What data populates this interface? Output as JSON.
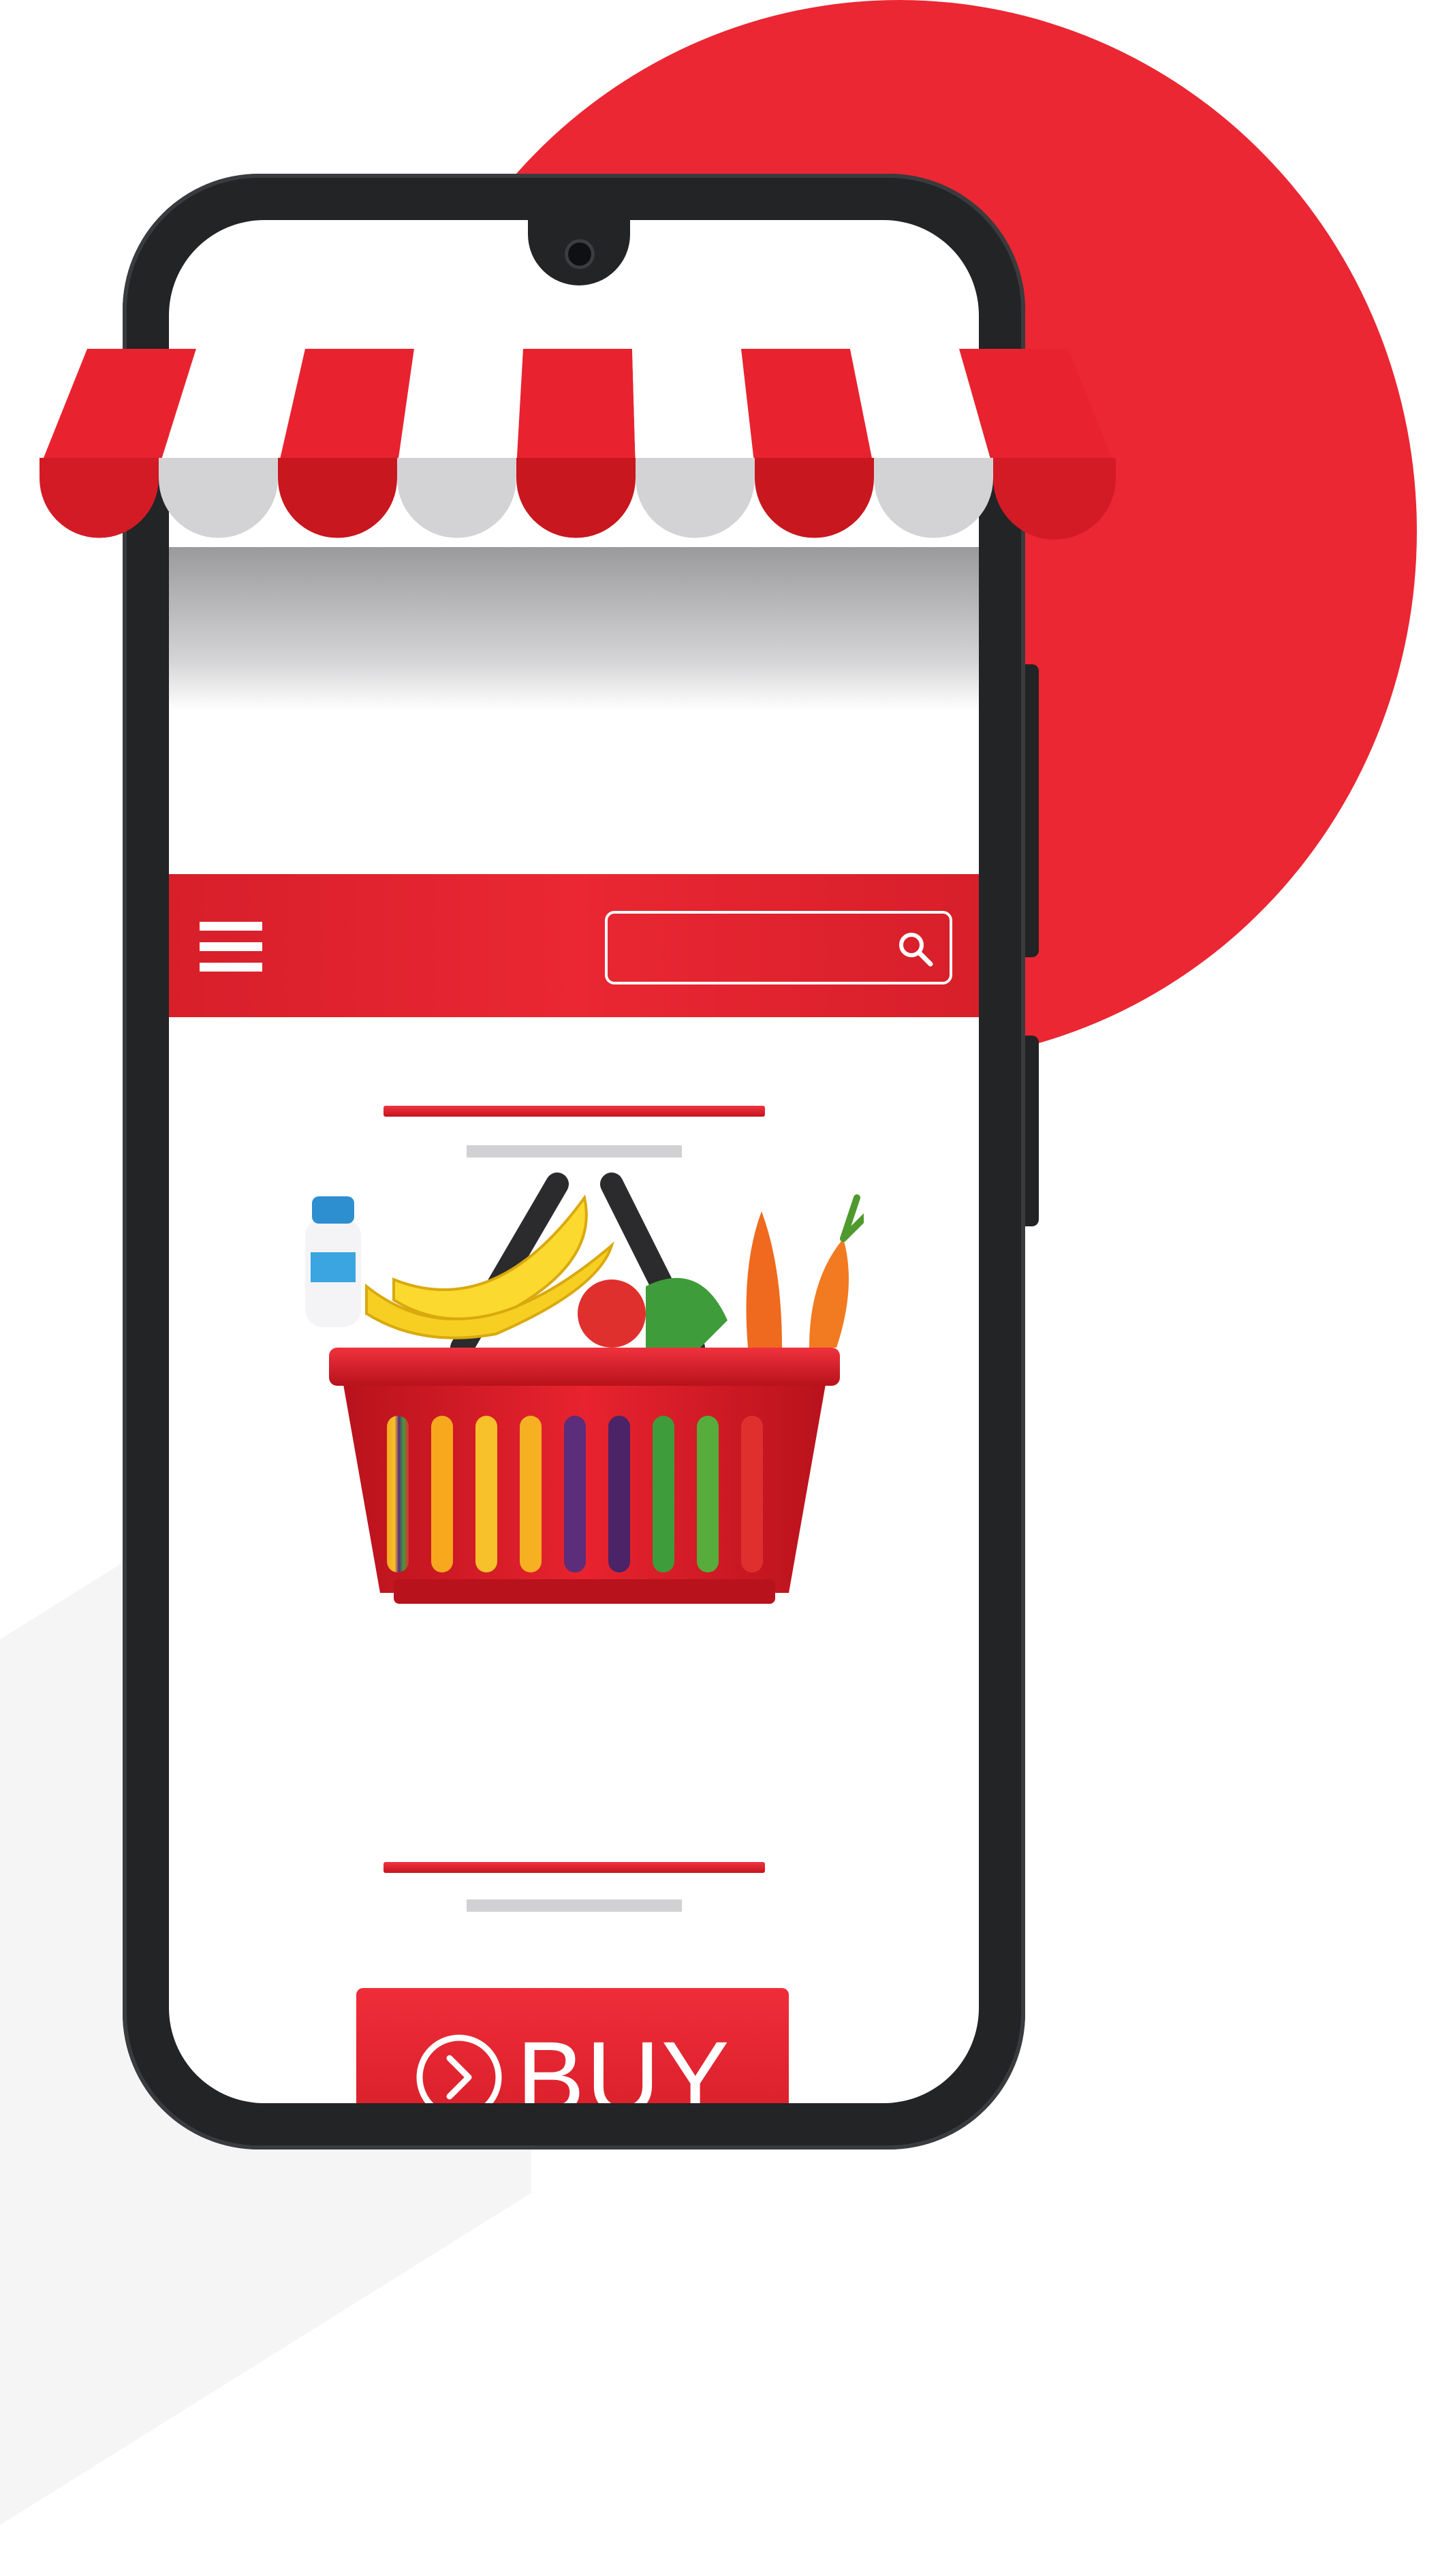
{
  "colors": {
    "brand_red": "#ea2733",
    "dark_red": "#c4141e",
    "phone_body": "#232426",
    "awning_white": "#ffffff",
    "placeholder_grey": "#d1d1d3"
  },
  "header": {
    "menu_icon": "hamburger-menu-icon",
    "search_placeholder": "",
    "search_icon": "search-icon"
  },
  "product": {
    "image": "grocery-basket"
  },
  "buy_button": {
    "label": "BUY",
    "icon": "chevron-circle-right-icon"
  }
}
